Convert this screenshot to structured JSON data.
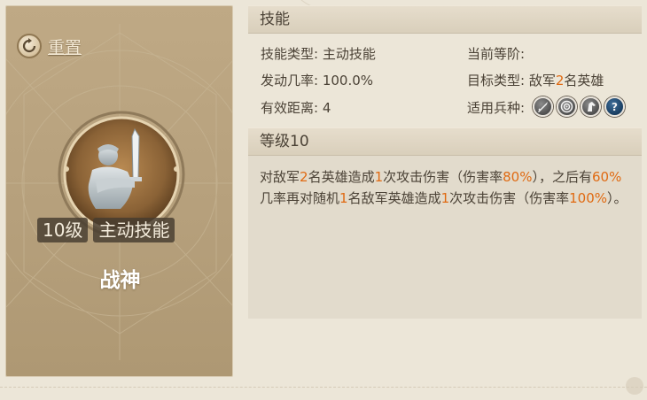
{
  "left": {
    "reset_label": "重置",
    "level_badge": "10级",
    "type_badge": "主动技能",
    "skill_name": "战神"
  },
  "skill": {
    "header": "技能",
    "type_label": "技能类型:",
    "type_value": "主动技能",
    "rank_label": "当前等阶:",
    "rank_value": "",
    "rate_label": "发动几率:",
    "rate_value": "100.0%",
    "target_label": "目标类型:",
    "target_pre": "敌军",
    "target_num": "2",
    "target_post": "名英雄",
    "range_label": "有效距离:",
    "range_value": "4",
    "troop_label": "适用兵种:",
    "troop_icons": [
      "sword-troop-icon",
      "archer-target-icon",
      "cavalry-horse-icon",
      "unknown-troop-icon"
    ]
  },
  "level": {
    "header": "等级10",
    "desc": {
      "p1": "对敌军",
      "n1": "2",
      "p2": "名英雄造成",
      "n2": "1",
      "p3": "次攻击伤害（伤害率",
      "n3": "80%",
      "p4": "），之后有",
      "n4": "60%",
      "p5": "几率再对随机",
      "n5": "1",
      "p6": "名敌军英雄造成",
      "n6": "1",
      "p7": "次攻击伤害（伤害率",
      "n7": "100%",
      "p8": "）。"
    }
  },
  "colors": {
    "highlight": "#e06a12",
    "panel": "#b6a07c",
    "background": "#ece6d8"
  }
}
